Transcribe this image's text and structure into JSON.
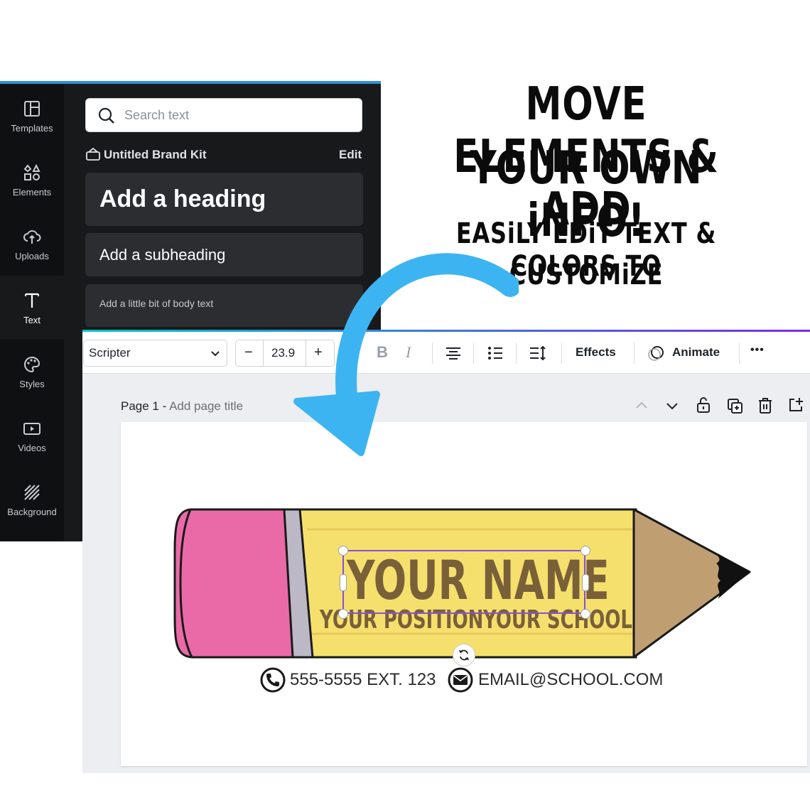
{
  "headline": {
    "line1": "MOVE ELEMENTS & ADD",
    "line2": "YOUR OWN iNFO!",
    "sub_line1": "EASiLY EDiT TEXT & COLORS TO",
    "sub_line2": "CUSTOMiZE"
  },
  "side_rail": {
    "items": [
      {
        "label": "Templates",
        "icon": "templates-icon"
      },
      {
        "label": "Elements",
        "icon": "elements-icon"
      },
      {
        "label": "Uploads",
        "icon": "upload-cloud-icon"
      },
      {
        "label": "Text",
        "icon": "text-icon",
        "active": true
      },
      {
        "label": "Styles",
        "icon": "palette-icon"
      },
      {
        "label": "Videos",
        "icon": "video-icon"
      },
      {
        "label": "Background",
        "icon": "background-hatch-icon"
      }
    ]
  },
  "text_panel": {
    "search_placeholder": "Search text",
    "brand_kit": "Untitled Brand Kit",
    "brand_edit": "Edit",
    "heading_card": "Add a heading",
    "subheading_card": "Add a subheading",
    "body_card": "Add a little bit of body text"
  },
  "toolbar": {
    "font": "Scripter",
    "size_minus": "−",
    "font_size": "23.9",
    "size_plus": "+",
    "bold": "B",
    "italic": "I",
    "effects": "Effects",
    "animate": "Animate",
    "more": "•••"
  },
  "page": {
    "label": "Page 1 -",
    "title_placeholder": "Add page title"
  },
  "design": {
    "name": "YOUR NAME",
    "position": "YOUR POSITION",
    "school": "YOUR SCHOOL",
    "phone": "555-5555 EXT. 123",
    "email": "EMAIL@SCHOOL.COM"
  },
  "colors": {
    "arrow": "#3db4f2",
    "eraser": "#ea6aa8",
    "pencil_body": "#f5e06e",
    "pencil_wood": "#bf9f72",
    "pencil_text": "#7a6038",
    "selection": "#8a4fd8"
  }
}
